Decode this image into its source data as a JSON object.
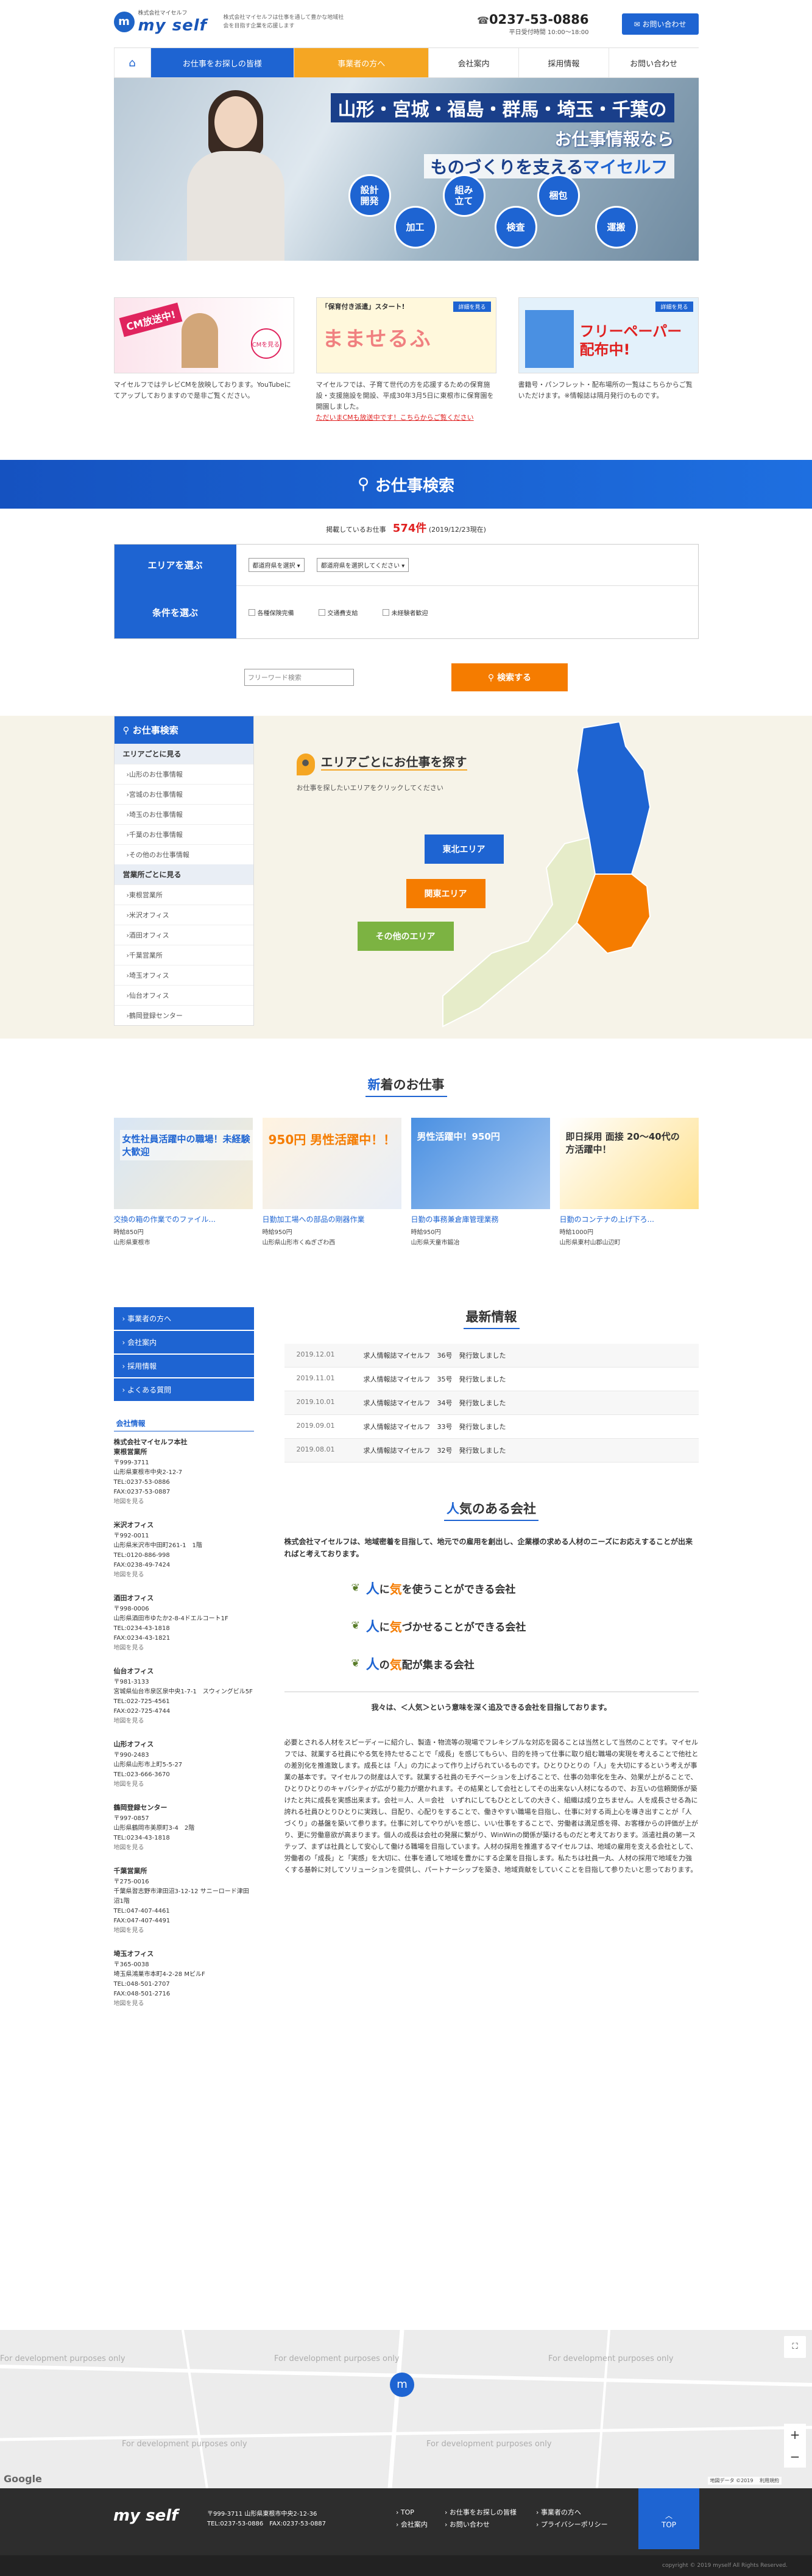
{
  "header": {
    "company_small": "株式会社マイセルフ",
    "logo": "my self",
    "tagline": "株式会社マイセルフは仕事を通して豊かな地域社会を目指す企業を応援します",
    "tel": "0237-53-0886",
    "hours": "平日受付時間 10:00〜18:00",
    "contact": "お問い合わせ"
  },
  "nav": {
    "home_icon": "home-icon",
    "items": [
      "お仕事をお探しの皆様",
      "事業者の方へ",
      "会社案内",
      "採用情報",
      "お問い合わせ"
    ]
  },
  "hero": {
    "line1": "山形・宮城・福島・群馬・埼玉・千葉の",
    "line2": "お仕事情報なら",
    "line3a": "ものづくりを支える",
    "line3b": "マイセルフ",
    "circles": [
      "設計\n開発",
      "組み\n立て",
      "梱包",
      "加工",
      "検査",
      "運搬"
    ]
  },
  "news_cards": [
    {
      "img_text": "CM放送中!",
      "img_sub": "CMを見る",
      "text": "マイセルフではテレビCMを放映しております。YouTubeにてアップしておりますので是非ご覧ください。"
    },
    {
      "img_text": "「保育付き派遣」スタート!",
      "img_sub": "詳細を見る",
      "img_big": "まませるふ",
      "text": "マイセルフでは、子育て世代の方を応援するための保育施設・支援施設を開設、平成30年3月5日に東根市に保育園を開園しました。",
      "link": "ただいまCMも放送中です！こちらからご覧ください"
    },
    {
      "img_text": "詳細を見る",
      "img_big": "フリーペーパー配布中!",
      "text": "書籍号・パンフレット・配布場所の一覧はこちらからご覧いただけます。※情報誌は隔月発行のものです。"
    }
  ],
  "search": {
    "title": "お仕事検索",
    "count_prefix": "掲載しているお仕事",
    "count": "574件",
    "count_date": "(2019/12/23現在)",
    "area_label": "エリアを選ぶ",
    "area_pref": "都道府県を選択 ▾",
    "area_city": "都道府県を選択してください ▾",
    "cond_label": "条件を選ぶ",
    "conds": [
      "各種保険完備",
      "交通費支給",
      "未経験者歓迎"
    ],
    "freeword": "フリーワード検索",
    "button": "検索する"
  },
  "side_search": {
    "title": "お仕事検索",
    "area_head": "エリアごとに見る",
    "areas": [
      "山形のお仕事情報",
      "宮城のお仕事情報",
      "埼玉のお仕事情報",
      "千葉のお仕事情報",
      "その他のお仕事情報"
    ],
    "office_head": "営業所ごとに見る",
    "offices": [
      "東根営業所",
      "米沢オフィス",
      "酒田オフィス",
      "千葉営業所",
      "埼玉オフィス",
      "仙台オフィス",
      "鶴岡登録センター"
    ]
  },
  "area_map": {
    "title": "エリアごとにお仕事を探す",
    "sub": "お仕事を探したいエリアをクリックしてください",
    "buttons": [
      "東北エリア",
      "関東エリア",
      "その他のエリア"
    ]
  },
  "new_jobs": {
    "title_em": "新",
    "title_rest": "着のお仕事",
    "items": [
      {
        "img": "女性社員活躍中の職場！未経験大歓迎",
        "title": "交換の箱の作業でのファイル...",
        "wage": "時給850円",
        "place": "山形県東根市"
      },
      {
        "img": "950円 男性活躍中！！",
        "title": "日勤加工場への部品の剛器作業",
        "wage": "時給950円",
        "place": "山形県山形市くぬぎざわ西"
      },
      {
        "img": "男性活躍中！950円",
        "title": "日勤の事務兼倉庫管理業務",
        "wage": "時給950円",
        "place": "山形県天童市鍛冶"
      },
      {
        "img": "即日採用 面接 20〜40代の方活躍中！",
        "title": "日勤のコンテナの上げ下ろ...",
        "wage": "時給1000円",
        "place": "山形県東村山郡山辺町"
      }
    ]
  },
  "lower_nav": [
    "事業者の方へ",
    "会社案内",
    "採用情報",
    "よくある質問"
  ],
  "company": {
    "title": "会社情報",
    "offices": [
      {
        "name": "株式会社マイセルフ本社\n東根営業所",
        "lines": [
          "〒999-3711",
          "山形県東根市中央2-12-7",
          "TEL:0237-53-0886",
          "FAX:0237-53-0887"
        ],
        "link": "地図を見る"
      },
      {
        "name": "米沢オフィス",
        "lines": [
          "〒992-0011",
          "山形県米沢市中田町261-1　1階",
          "TEL:0120-886-998",
          "FAX:0238-49-7424"
        ],
        "link": "地図を見る"
      },
      {
        "name": "酒田オフィス",
        "lines": [
          "〒998-0006",
          "山形県酒田市ゆたか2-8-4ドエルコート1F",
          "TEL:0234-43-1818",
          "FAX:0234-43-1821"
        ],
        "link": "地図を見る"
      },
      {
        "name": "仙台オフィス",
        "lines": [
          "〒981-3133",
          "宮城県仙台市泉区泉中央1-7-1　スウィングビル5F",
          "TEL:022-725-4561",
          "FAX:022-725-4744"
        ],
        "link": "地図を見る"
      },
      {
        "name": "山形オフィス",
        "lines": [
          "〒990-2483",
          "山形県山形市上町5-5-27",
          "TEL:023-666-3670"
        ],
        "link": "地図を見る"
      },
      {
        "name": "鶴岡登録センター",
        "lines": [
          "〒997-0857",
          "山形県鶴岡市美原町3-4　2階",
          "TEL:0234-43-1818"
        ],
        "link": "地図を見る"
      },
      {
        "name": "千葉営業所",
        "lines": [
          "〒275-0016",
          "千葉県習志野市津田沼3-12-12 サニーロード津田沼1階",
          "TEL:047-407-4461",
          "FAX:047-407-4491"
        ],
        "link": "地図を見る"
      },
      {
        "name": "埼玉オフィス",
        "lines": [
          "〒365-0038",
          "埼玉県鴻巣市本町4-2-28 MビルF",
          "TEL:048-501-2707",
          "FAX:048-501-2716"
        ],
        "link": "地図を見る"
      }
    ]
  },
  "latest_news": {
    "title": "最新情報",
    "items": [
      {
        "date": "2019.12.01",
        "text": "求人情報誌マイセルフ　36号　発行致しました"
      },
      {
        "date": "2019.11.01",
        "text": "求人情報誌マイセルフ　35号　発行致しました"
      },
      {
        "date": "2019.10.01",
        "text": "求人情報誌マイセルフ　34号　発行致しました"
      },
      {
        "date": "2019.09.01",
        "text": "求人情報誌マイセルフ　33号　発行致しました"
      },
      {
        "date": "2019.08.01",
        "text": "求人情報誌マイセルフ　32号　発行致しました"
      }
    ]
  },
  "popular": {
    "title_em": "人",
    "title_rest": "気のある会社",
    "intro": "株式会社マイセルフは、地域密着を目指して、地元での雇用を創出し、企業様の求める人材のニーズにお応えすることが出来ればと考えております。",
    "points": [
      {
        "a": "人",
        "b": "に",
        "c": "気",
        "d": "を使うことができる会社"
      },
      {
        "a": "人",
        "b": "に",
        "c": "気",
        "d": "づかせることができる会社"
      },
      {
        "a": "人",
        "b": "の",
        "c": "気",
        "d": "配が集まる会社"
      }
    ],
    "motto": "我々は、＜人気＞という意味を深く追及できる会社を目指しております。",
    "body": "必要とされる人材をスピーディーに紹介し、製造・物流等の現場でフレキシブルな対応を図ることは当然として当然のことです。マイセルフでは、就業する社員にやる気を持たせることで「成長」を感じてもらい、目的を持って仕事に取り組む職場の実現を考えることで他社との差別化を推進致します。成長とは「人」の力によって作り上げられているものです。ひとりひとりの「人」を大切にするという考えが事業の基本です。マイセルフの財産は人です。就業する社員のモチベーションを上げることで、仕事の効率化を生み、効果が上がることで、ひとりひとりのキャパシティが広がり能力が磨かれます。その結果として会社としてその出来ない人材になるので、お互いの信頼関係が築けたと共に成長を実感出来ます。会社＝人、人＝会社　いずれにしてもひととしての大きく、組織は成り立ちません。人を成長させる為に誇れる社員ひとりひとりに実践し、目配り、心配りをすることで、働きやすい職場を目指し、仕事に対する両上心を導き出すことが「人づくり」の基盤を築いて参ります。仕事に対してやりがいを感じ、いい仕事をすることで、労働者は満足感を得、お客様からの評価が上がり、更に労働意欲が高まります。個人の成長は会社の発展に繋がり、WinWinの関係が築けるものだと考えております。派遣社員の第一ステップ、まずは社員として安心して働ける職場を目指しています。人材の採用を推進するマイセルフは、地域の雇用を支える会社として、労働者の「成長」と「実感」を大切に、仕事を通して地域を豊かにする企業を目指します。私たちは社員一丸、人材の採用で地域を力強くする基幹に対してソリューションを提供し、パートナーシップを築き、地域貢献をしていくことを目指して参りたいと思っております。"
  },
  "map": {
    "dev_text": "For development purposes only",
    "google": "Google",
    "zoom_in": "+",
    "zoom_out": "−",
    "attribution": "地図データ ©2019 　利用規約"
  },
  "footer": {
    "logo": "my self",
    "address": "〒999-3711 山形県東根市中央2-12-36",
    "tel": "TEL:0237-53-0886　FAX:0237-53-0887",
    "links_col1": [
      "TOP",
      "会社案内"
    ],
    "links_col2": [
      "お仕事をお探しの皆様",
      "お問い合わせ"
    ],
    "links_col3": [
      "事業者の方へ",
      "プライバシーポリシー"
    ],
    "top_button": "TOP",
    "copyright": "copyright © 2019 myself All Rights Reserved."
  }
}
